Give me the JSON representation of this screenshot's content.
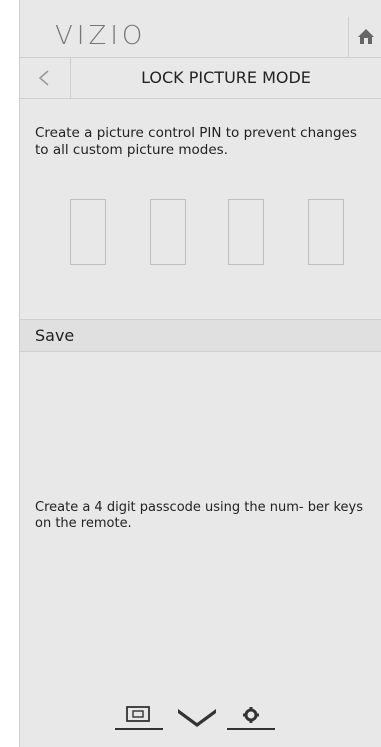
{
  "header": {
    "logo": "VIZIO",
    "home_icon": "home-icon",
    "back_icon": "back-arrow-icon",
    "title": "LOCK PICTURE MODE"
  },
  "content": {
    "description": "Create a picture control PIN to prevent changes to all custom picture modes.",
    "pin_digits": [
      "",
      "",
      "",
      ""
    ],
    "save_label": "Save",
    "hint": "Create a 4 digit passcode using the num- ber keys on the remote."
  },
  "bottom_nav": {
    "items": [
      {
        "icon": "input-icon"
      },
      {
        "icon": "chevron-down-icon"
      },
      {
        "icon": "settings-icon"
      }
    ]
  },
  "colors": {
    "panel_bg": "#e8e8e8",
    "border": "#cfcfcf",
    "text": "#222222",
    "nav_icon": "#333333"
  }
}
